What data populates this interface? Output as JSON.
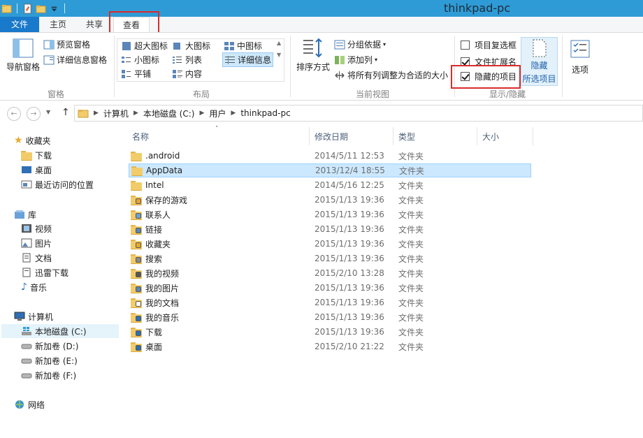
{
  "window": {
    "title": "thinkpad-pc"
  },
  "colors": {
    "titlebar": "#2e9bd6",
    "file_tab": "#1979ca",
    "highlight_box": "#d92b2b",
    "selection": "#cce8ff"
  },
  "tabs": [
    "文件",
    "主页",
    "共享",
    "查看"
  ],
  "ribbon": {
    "panes": {
      "nav_pane": "导航窗格",
      "preview_pane": "预览窗格",
      "details_pane": "详细信息窗格",
      "label": "窗格"
    },
    "layout": {
      "items": [
        "超大图标",
        "大图标",
        "中图标",
        "小图标",
        "列表",
        "详细信息",
        "平铺",
        "内容"
      ],
      "selected": "详细信息",
      "label": "布局"
    },
    "current_view": {
      "sort_by": "排序方式",
      "group_by": "分组依据",
      "add_columns": "添加列",
      "size_all_columns": "将所有列调整为合适的大小",
      "label": "当前视图"
    },
    "show_hide": {
      "item_checkboxes": {
        "label": "项目复选框",
        "checked": false
      },
      "file_extensions": {
        "label": "文件扩展名",
        "checked": true
      },
      "hidden_items": {
        "label": "隐藏的项目",
        "checked": true
      },
      "hide_selected_line1": "隐藏",
      "hide_selected_line2": "所选项目",
      "label": "显示/隐藏"
    },
    "options": "选项"
  },
  "address": {
    "crumbs": [
      "计算机",
      "本地磁盘 (C:)",
      "用户",
      "thinkpad-pc"
    ]
  },
  "nav": {
    "favorites": {
      "label": "收藏夹",
      "items": [
        "下载",
        "桌面",
        "最近访问的位置"
      ]
    },
    "libraries": {
      "label": "库",
      "items": [
        "视频",
        "图片",
        "文档",
        "迅雷下载",
        "音乐"
      ]
    },
    "computer": {
      "label": "计算机",
      "items": [
        "本地磁盘 (C:)",
        "新加卷 (D:)",
        "新加卷 (E:)",
        "新加卷 (F:)"
      ],
      "selected": "本地磁盘 (C:)"
    },
    "network": {
      "label": "网络"
    }
  },
  "columns": {
    "name": "名称",
    "modified": "修改日期",
    "type": "类型",
    "size": "大小"
  },
  "files": [
    {
      "name": ".android",
      "date": "2014/5/11 12:53",
      "type": "文件夹",
      "icon": "folder-icon"
    },
    {
      "name": "AppData",
      "date": "2013/12/4 18:55",
      "type": "文件夹",
      "icon": "folder-icon",
      "selected": true
    },
    {
      "name": "Intel",
      "date": "2014/5/16 12:25",
      "type": "文件夹",
      "icon": "folder-icon"
    },
    {
      "name": "保存的游戏",
      "date": "2015/1/13 19:36",
      "type": "文件夹",
      "icon": "saved-games-icon"
    },
    {
      "name": "联系人",
      "date": "2015/1/13 19:36",
      "type": "文件夹",
      "icon": "contacts-icon"
    },
    {
      "name": "链接",
      "date": "2015/1/13 19:36",
      "type": "文件夹",
      "icon": "links-icon"
    },
    {
      "name": "收藏夹",
      "date": "2015/1/13 19:36",
      "type": "文件夹",
      "icon": "favorites-icon"
    },
    {
      "name": "搜索",
      "date": "2015/1/13 19:36",
      "type": "文件夹",
      "icon": "searches-icon"
    },
    {
      "name": "我的视频",
      "date": "2015/2/10 13:28",
      "type": "文件夹",
      "icon": "videos-icon"
    },
    {
      "name": "我的图片",
      "date": "2015/1/13 19:36",
      "type": "文件夹",
      "icon": "pictures-icon"
    },
    {
      "name": "我的文档",
      "date": "2015/1/13 19:36",
      "type": "文件夹",
      "icon": "documents-icon"
    },
    {
      "name": "我的音乐",
      "date": "2015/1/13 19:36",
      "type": "文件夹",
      "icon": "music-icon"
    },
    {
      "name": "下载",
      "date": "2015/1/13 19:36",
      "type": "文件夹",
      "icon": "downloads-icon"
    },
    {
      "name": "桌面",
      "date": "2015/2/10 21:22",
      "type": "文件夹",
      "icon": "desktop-icon"
    }
  ]
}
